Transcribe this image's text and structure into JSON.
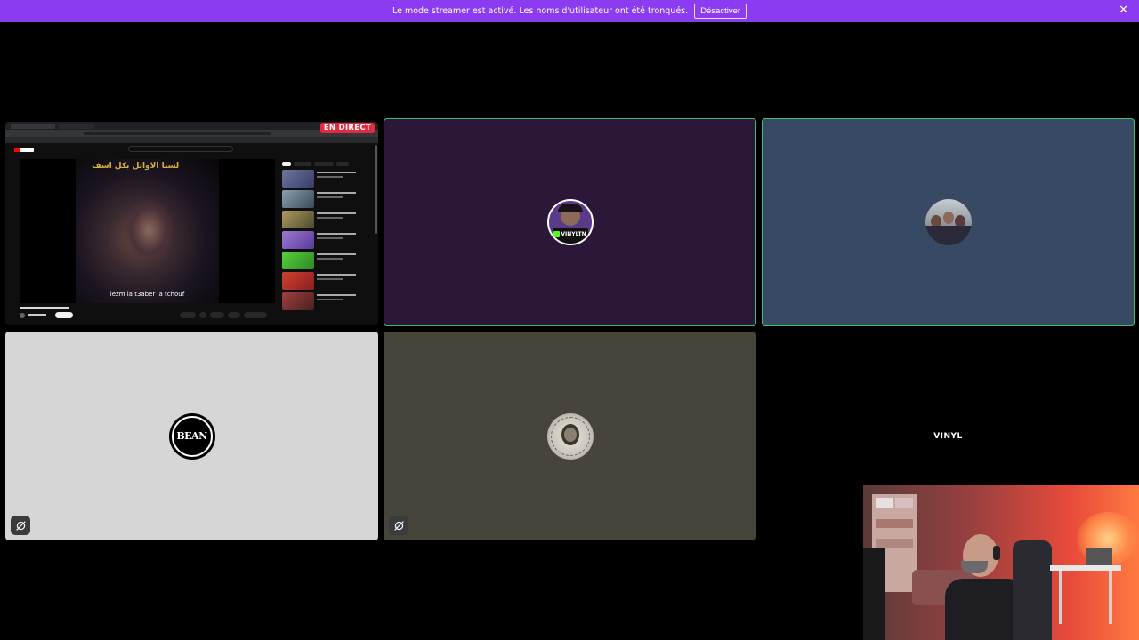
{
  "banner": {
    "message": "Le mode streamer est activé. Les noms d'utilisateur ont été tronqués.",
    "disable_label": "Désactiver",
    "close_icon": "close-icon",
    "color": "#8b3cf0"
  },
  "screenshare": {
    "live_badge": "EN DIRECT",
    "video_caption": "lezm la t3aber la tchouf",
    "video_title_art": "لسنا الاوائل بكل اسف"
  },
  "tiles": [
    {
      "id": "tile-vinyltn",
      "avatar_text": "VINYLTN",
      "background": "#2c1738",
      "speaking": true
    },
    {
      "id": "tile-group-photo",
      "background": "#384a63",
      "speaking": true
    },
    {
      "id": "tile-bean",
      "avatar_text": "BEAN",
      "background": "#d6d6d6",
      "muted": true
    },
    {
      "id": "tile-sketch",
      "background": "#47443c",
      "muted": true
    },
    {
      "id": "tile-vinyl",
      "avatar_text": "VINYL",
      "background": "#000000"
    }
  ],
  "colors": {
    "speaking_outline": "#3fbf72",
    "live_badge": "#e5293e"
  }
}
